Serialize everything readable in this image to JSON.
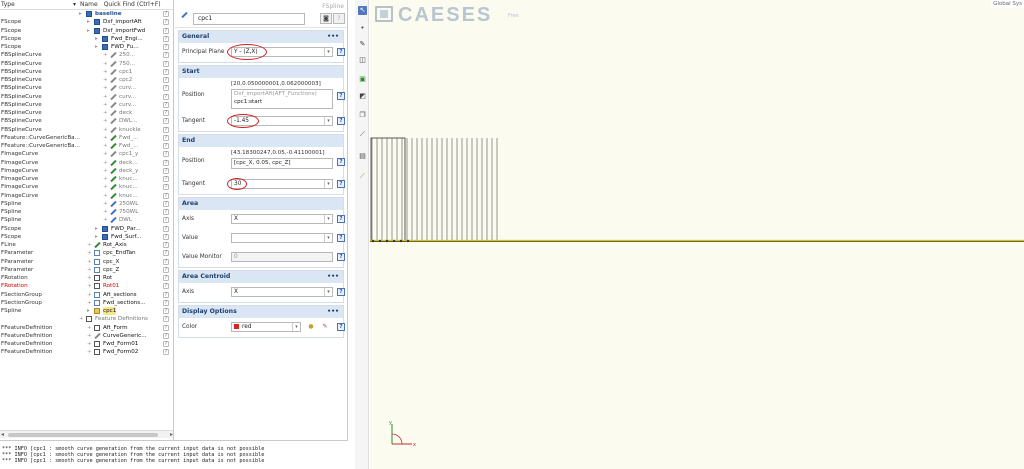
{
  "tree": {
    "header": {
      "type": "Type",
      "name": "Name",
      "quick_find": "Quick Find (Ctrl+F)"
    },
    "rows": [
      {
        "type": "",
        "name": "baseline",
        "depth": 0,
        "icon": "folder",
        "bold": true
      },
      {
        "type": "FScope",
        "name": "Dxf_importAft",
        "depth": 1,
        "icon": "folder"
      },
      {
        "type": "FScope",
        "name": "Dxf_importFwd",
        "depth": 1,
        "icon": "folder"
      },
      {
        "type": "FScope",
        "name": "Fwd_Engi...",
        "depth": 2,
        "icon": "folder"
      },
      {
        "type": "FScope",
        "name": "FWD_Fu...",
        "depth": 2,
        "icon": "folder"
      },
      {
        "type": "FBSplineCurve",
        "name": "250...",
        "depth": 3,
        "icon": "curve-grey",
        "muted": true
      },
      {
        "type": "FBSplineCurve",
        "name": "750...",
        "depth": 3,
        "icon": "curve-grey",
        "muted": true
      },
      {
        "type": "FBSplineCurve",
        "name": "cpc1",
        "depth": 3,
        "icon": "curve-grey",
        "muted": true
      },
      {
        "type": "FBSplineCurve",
        "name": "cpc2",
        "depth": 3,
        "icon": "curve-grey",
        "muted": true
      },
      {
        "type": "FBSplineCurve",
        "name": "curv...",
        "depth": 3,
        "icon": "curve-grey",
        "muted": true
      },
      {
        "type": "FBSplineCurve",
        "name": "curv...",
        "depth": 3,
        "icon": "curve-grey",
        "muted": true
      },
      {
        "type": "FBSplineCurve",
        "name": "curv...",
        "depth": 3,
        "icon": "curve-grey",
        "muted": true
      },
      {
        "type": "FBSplineCurve",
        "name": "deck",
        "depth": 3,
        "icon": "curve-grey",
        "muted": true
      },
      {
        "type": "FBSplineCurve",
        "name": "DWL...",
        "depth": 3,
        "icon": "curve-grey",
        "muted": true
      },
      {
        "type": "FBSplineCurve",
        "name": "knuckle",
        "depth": 3,
        "icon": "curve-grey",
        "muted": true
      },
      {
        "type": "FFeature::CurveGenericBa...",
        "name": "Fwd_...",
        "depth": 3,
        "icon": "curve",
        "muted": true
      },
      {
        "type": "FFeature::CurveGenericBa...",
        "name": "Fwd_...",
        "depth": 3,
        "icon": "curve",
        "muted": true
      },
      {
        "type": "FImageCurve",
        "name": "cpc1_y",
        "depth": 3,
        "icon": "curve-grey",
        "muted": true
      },
      {
        "type": "FImageCurve",
        "name": "deck...",
        "depth": 3,
        "icon": "curve",
        "muted": true
      },
      {
        "type": "FImageCurve",
        "name": "deck_y",
        "depth": 3,
        "icon": "curve",
        "muted": true
      },
      {
        "type": "FImageCurve",
        "name": "knuc...",
        "depth": 3,
        "icon": "curve",
        "muted": true
      },
      {
        "type": "FImageCurve",
        "name": "knuc...",
        "depth": 3,
        "icon": "curve",
        "muted": true
      },
      {
        "type": "FImageCurve",
        "name": "knuc...",
        "depth": 3,
        "icon": "curve",
        "muted": true
      },
      {
        "type": "FSpline",
        "name": "250WL",
        "depth": 3,
        "icon": "curve-blue",
        "muted": true
      },
      {
        "type": "FSpline",
        "name": "750WL",
        "depth": 3,
        "icon": "curve-blue",
        "muted": true
      },
      {
        "type": "FSpline",
        "name": "DWL",
        "depth": 3,
        "icon": "curve-blue",
        "muted": true
      },
      {
        "type": "FScope",
        "name": "FWD_Par...",
        "depth": 2,
        "icon": "folder"
      },
      {
        "type": "FScope",
        "name": "Fwd_Surf...",
        "depth": 2,
        "icon": "folder"
      },
      {
        "type": "FLine",
        "name": "Rot_Axis",
        "depth": 1,
        "icon": "curve"
      },
      {
        "type": "FParameter",
        "name": "cpc_EndTan",
        "depth": 1,
        "icon": "param"
      },
      {
        "type": "FParameter",
        "name": "cpc_X",
        "depth": 1,
        "icon": "param"
      },
      {
        "type": "FParameter",
        "name": "cpc_Z",
        "depth": 1,
        "icon": "param"
      },
      {
        "type": "FRotation",
        "name": "Rot",
        "depth": 1,
        "icon": "doc"
      },
      {
        "type": "FRotation",
        "name": "Rot01",
        "depth": 1,
        "icon": "doc",
        "red": true
      },
      {
        "type": "FSectionGroup",
        "name": "Aft_sections",
        "depth": 1,
        "icon": "param"
      },
      {
        "type": "FSectionGroup",
        "name": "Fwd_sections...",
        "depth": 1,
        "icon": "param"
      },
      {
        "type": "FSpline",
        "name": "cpc1",
        "depth": 1,
        "icon": "folder-y",
        "selected": true
      },
      {
        "type": "",
        "name": "Feature Definitions",
        "depth": 0,
        "icon": "doc",
        "muted": true
      },
      {
        "type": "FFeatureDefinition",
        "name": "Aft_Form",
        "depth": 1,
        "icon": "doc"
      },
      {
        "type": "FFeatureDefinition",
        "name": "CurveGeneric...",
        "depth": 1,
        "icon": "curve-grey"
      },
      {
        "type": "FFeatureDefinition",
        "name": "Fwd_Form01",
        "depth": 1,
        "icon": "doc"
      },
      {
        "type": "FFeatureDefinition",
        "name": "Fwd_Form02",
        "depth": 1,
        "icon": "doc"
      }
    ]
  },
  "props": {
    "kind": "FSpline",
    "name": "cpc1",
    "sections": {
      "general": {
        "title": "General",
        "principal_plane_label": "Principal Plane",
        "principal_plane_value": "Y - (Z,X)"
      },
      "start": {
        "title": "Start",
        "position_label": "Position",
        "position_value": "[20,0.050000001,0.062000003]",
        "position_hint": "Dxf_importAft(AFT_Functions)",
        "position_expr": "cpc1:start",
        "tangent_label": "Tangent",
        "tangent_value": "-1.45"
      },
      "end": {
        "title": "End",
        "position_label": "Position",
        "position_value": "[43.18300247,0.05,-0.41100001]",
        "position_expr": "[cpc_X, 0.05, cpc_Z]",
        "tangent_label": "Tangent",
        "tangent_value": "30"
      },
      "area": {
        "title": "Area",
        "axis_label": "Axis",
        "axis_value": "X",
        "value_label": "Value",
        "value_value": "",
        "monitor_label": "Value Monitor",
        "monitor_value": "0"
      },
      "area_centroid": {
        "title": "Area Centroid",
        "axis_label": "Axis",
        "axis_value": "X"
      },
      "display": {
        "title": "Display Options",
        "color_label": "Color",
        "color_value": "red"
      }
    },
    "section_menu": "•••",
    "help_glyph": "?"
  },
  "log": {
    "lines": [
      "*** INFO [cpc1 : smooth curve generation from the current input data is not possible",
      "*** INFO [cpc1 : smooth curve generation from the current input data is not possible",
      "*** INFO [cpc1 : smooth curve generation from the current input data is not possible"
    ]
  },
  "viewport": {
    "logo": "CAESES",
    "logo_sub": "Free",
    "coord_sys": "Global Sys",
    "axis_y": "y",
    "axis_x": "x"
  },
  "colors": {
    "accent": "#5277c0",
    "section_head_bg": "#dbe6f5",
    "selection": "#f6e78a",
    "annotation": "#d02020",
    "viewport_bg": "#fbfbf0",
    "curve_line": "#d6c700"
  }
}
